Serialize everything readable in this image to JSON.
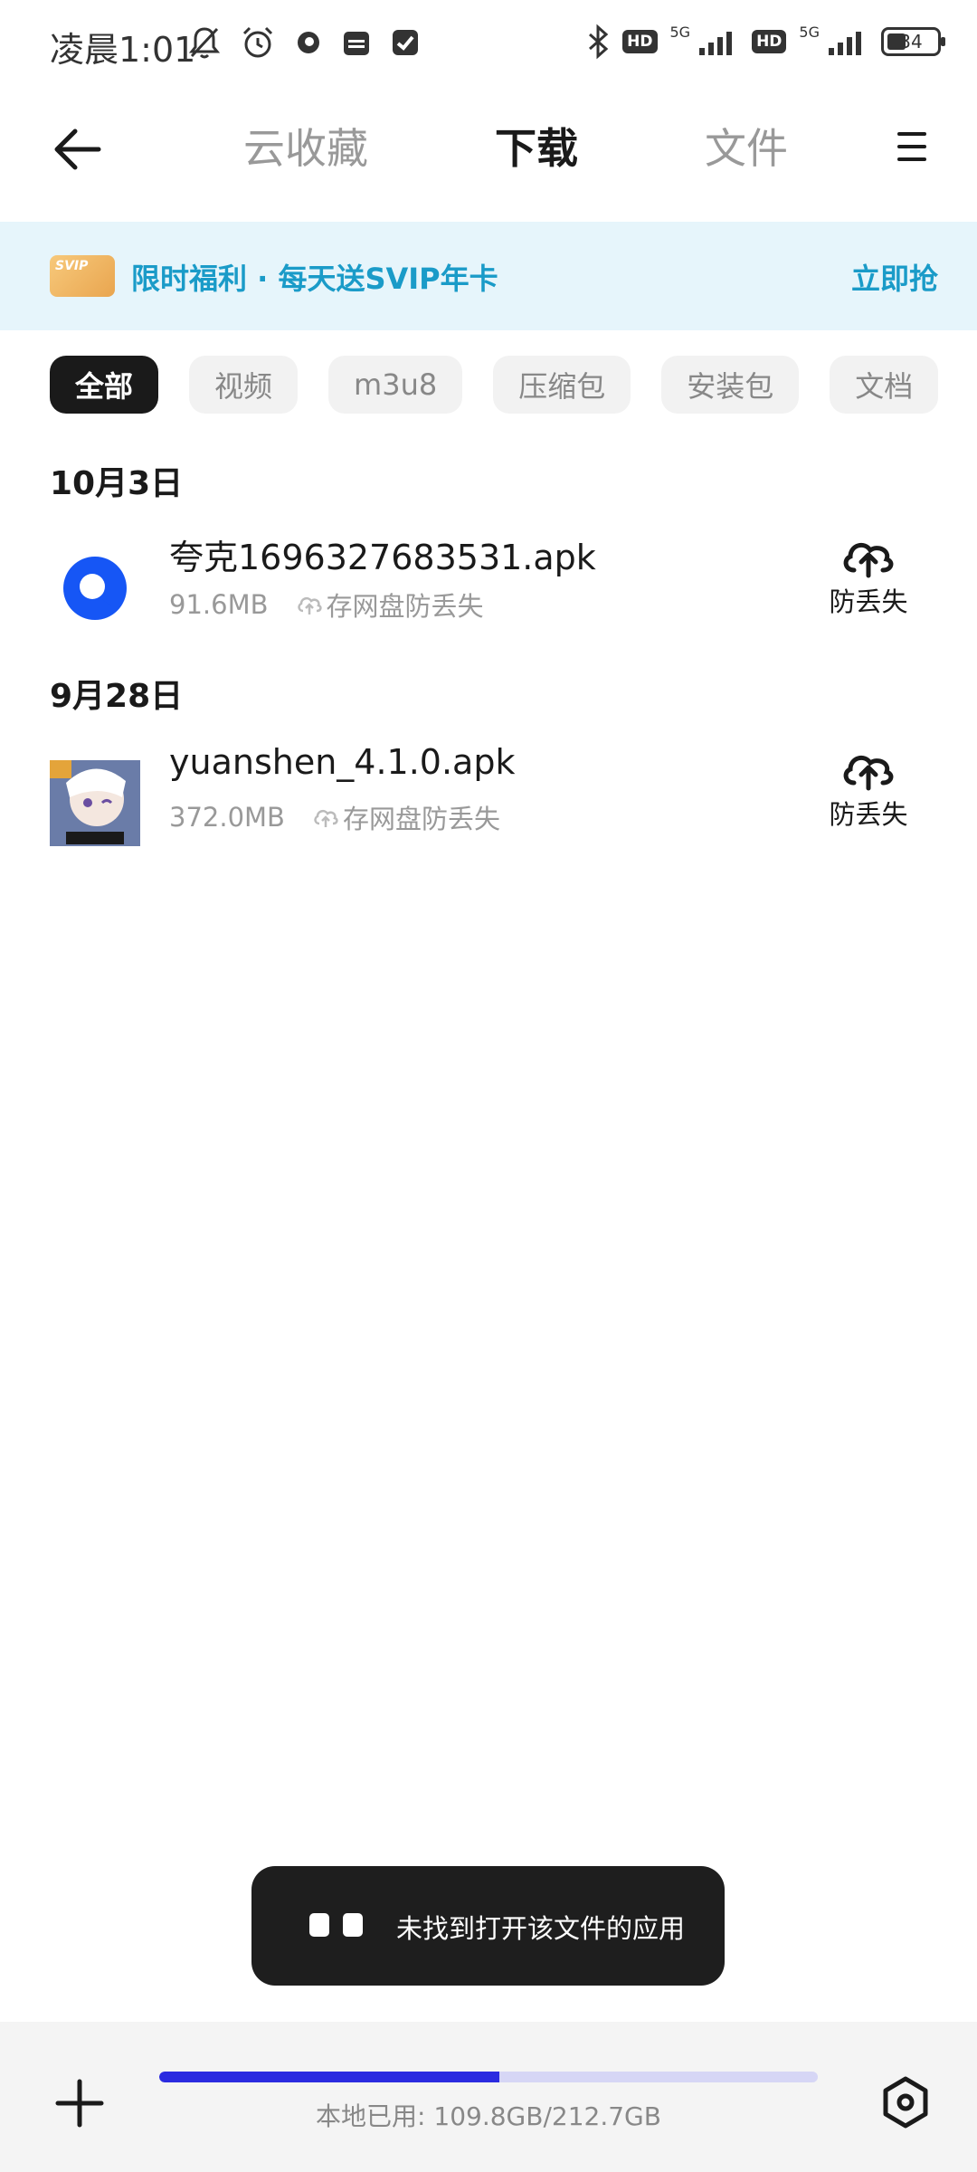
{
  "status_bar": {
    "time": "凌晨1:01",
    "left_icons": [
      "mute-bell-icon",
      "alarm-icon",
      "app-dot-icon",
      "calendar-icon",
      "check-app-icon"
    ],
    "right_icons": [
      "bluetooth-icon",
      "hd-icon",
      "signal-5g-icon",
      "hd-icon",
      "signal-5g-icon",
      "battery-icon"
    ],
    "hd_label": "HD",
    "net_label": "5G",
    "battery_level": "34"
  },
  "header": {
    "tabs": [
      {
        "label": "云收藏",
        "active": false
      },
      {
        "label": "下载",
        "active": true
      },
      {
        "label": "文件",
        "active": false
      }
    ]
  },
  "promo": {
    "badge": "SVIP",
    "text": "限时福利 · 每天送SVIP年卡",
    "cta": "立即抢"
  },
  "filters": [
    {
      "label": "全部",
      "active": true
    },
    {
      "label": "视频",
      "active": false
    },
    {
      "label": "m3u8",
      "active": false
    },
    {
      "label": "压缩包",
      "active": false
    },
    {
      "label": "安装包",
      "active": false
    },
    {
      "label": "文档",
      "active": false
    }
  ],
  "groups": [
    {
      "date": "10月3日",
      "files": [
        {
          "name": "夸克1696327683531.apk",
          "size": "91.6MB",
          "backup_hint": "存网盘防丢失",
          "backup_label": "防丢失",
          "icon": "quark-app-icon"
        }
      ]
    },
    {
      "date": "9月28日",
      "files": [
        {
          "name": "yuanshen_4.1.0.apk",
          "size": "372.0MB",
          "backup_hint": "存网盘防丢失",
          "backup_label": "防丢失",
          "icon": "genshin-app-icon"
        }
      ]
    }
  ],
  "toast": {
    "text": "未找到打开该文件的应用"
  },
  "bottom_bar": {
    "storage_text": "本地已用: 109.8GB/212.7GB",
    "storage_used_fraction": 0.516,
    "accent": "#2b2be0",
    "track": "#d6d6f5"
  },
  "colors": {
    "promo_bg": "#e6f5fb",
    "promo_text": "#1a9bc8",
    "quark_blue": "#1656f5"
  }
}
